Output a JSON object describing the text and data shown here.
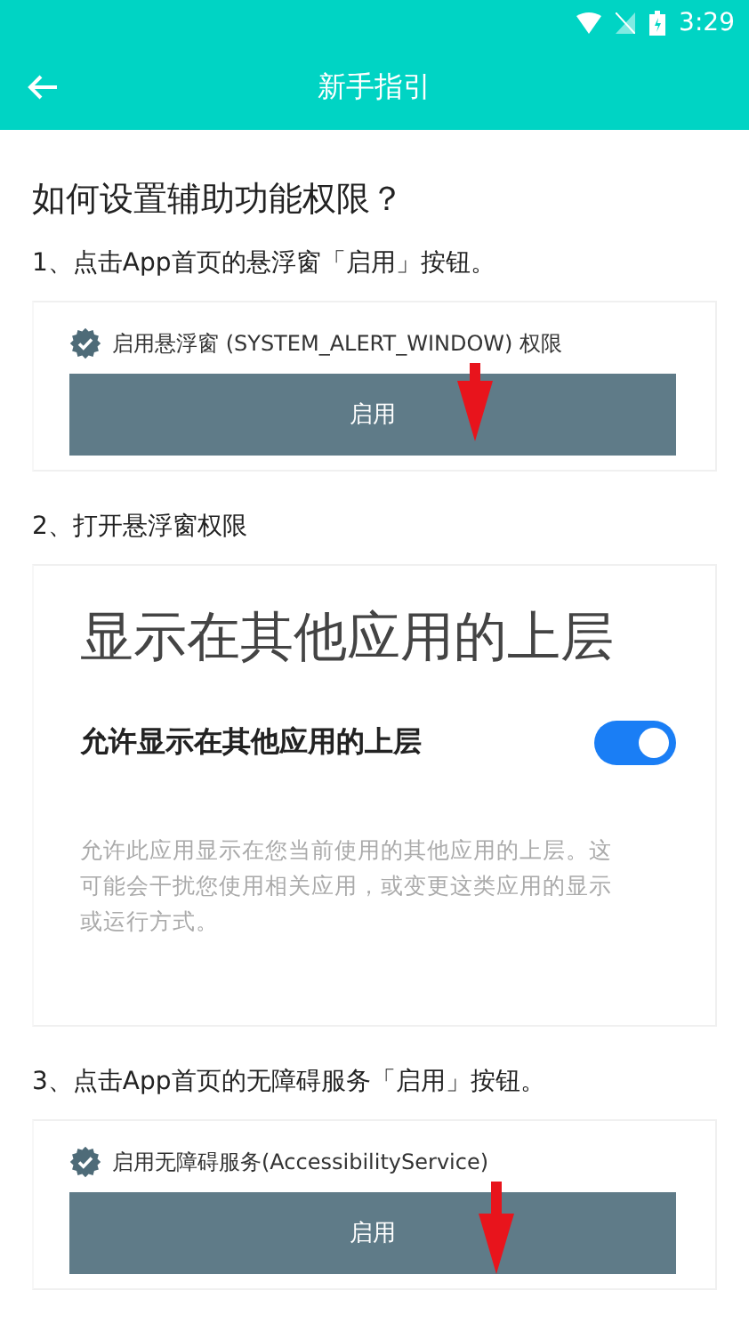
{
  "status_bar": {
    "time": "3:29"
  },
  "app_bar": {
    "title": "新手指引"
  },
  "heading": "如何设置辅助功能权限？",
  "steps": [
    {
      "kind": "permission",
      "text": "1、点击App首页的悬浮窗「启用」按钮。",
      "screenshot": {
        "checked": true,
        "label": "启用悬浮窗 (SYSTEM_ALERT_WINDOW) 权限",
        "button": "启用"
      }
    },
    {
      "kind": "overlay",
      "text": "2、打开悬浮窗权限",
      "screenshot": {
        "title": "显示在其他应用的上层",
        "toggle_label": "允许显示在其他应用的上层",
        "on": true,
        "description": "允许此应用显示在您当前使用的其他应用的上层。这可能会干扰您使用相关应用，或变更这类应用的显示或运行方式。"
      }
    },
    {
      "kind": "permission",
      "text": "3、点击App首页的无障碍服务「启用」按钮。",
      "screenshot": {
        "checked": true,
        "label": "启用无障碍服务(AccessibilityService)",
        "button": "启用"
      }
    }
  ]
}
